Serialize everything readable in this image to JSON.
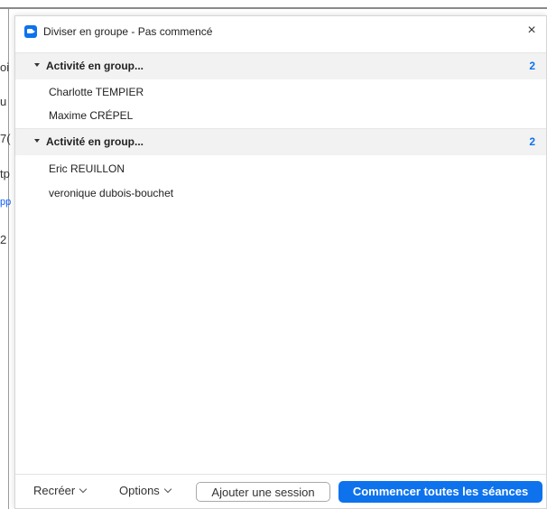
{
  "background": {
    "fragments": [
      "oi",
      "u",
      "7(",
      "tp",
      "pp",
      "2"
    ]
  },
  "dialog": {
    "title": "Diviser en groupe - Pas commencé",
    "close_glyph": "×",
    "groups": [
      {
        "name": "Activité en group...",
        "count": "2",
        "members": [
          "Charlotte TEMPIER",
          "Maxime CRÉPEL"
        ]
      },
      {
        "name": "Activité en group...",
        "count": "2",
        "members": [
          "Eric REUILLON",
          "veronique dubois-bouchet"
        ]
      }
    ]
  },
  "footer": {
    "recreate_label": "Recréer",
    "options_label": "Options",
    "add_session_label": "Ajouter une session",
    "start_all_label": "Commencer toutes les séances"
  },
  "colors": {
    "accent": "#0e72ed",
    "group_header_bg": "#f2f2f2"
  },
  "icons": {
    "app": "zoom-camera-icon",
    "close": "close-icon",
    "collapse": "caret-down-icon",
    "dropdown": "chevron-down-icon"
  }
}
